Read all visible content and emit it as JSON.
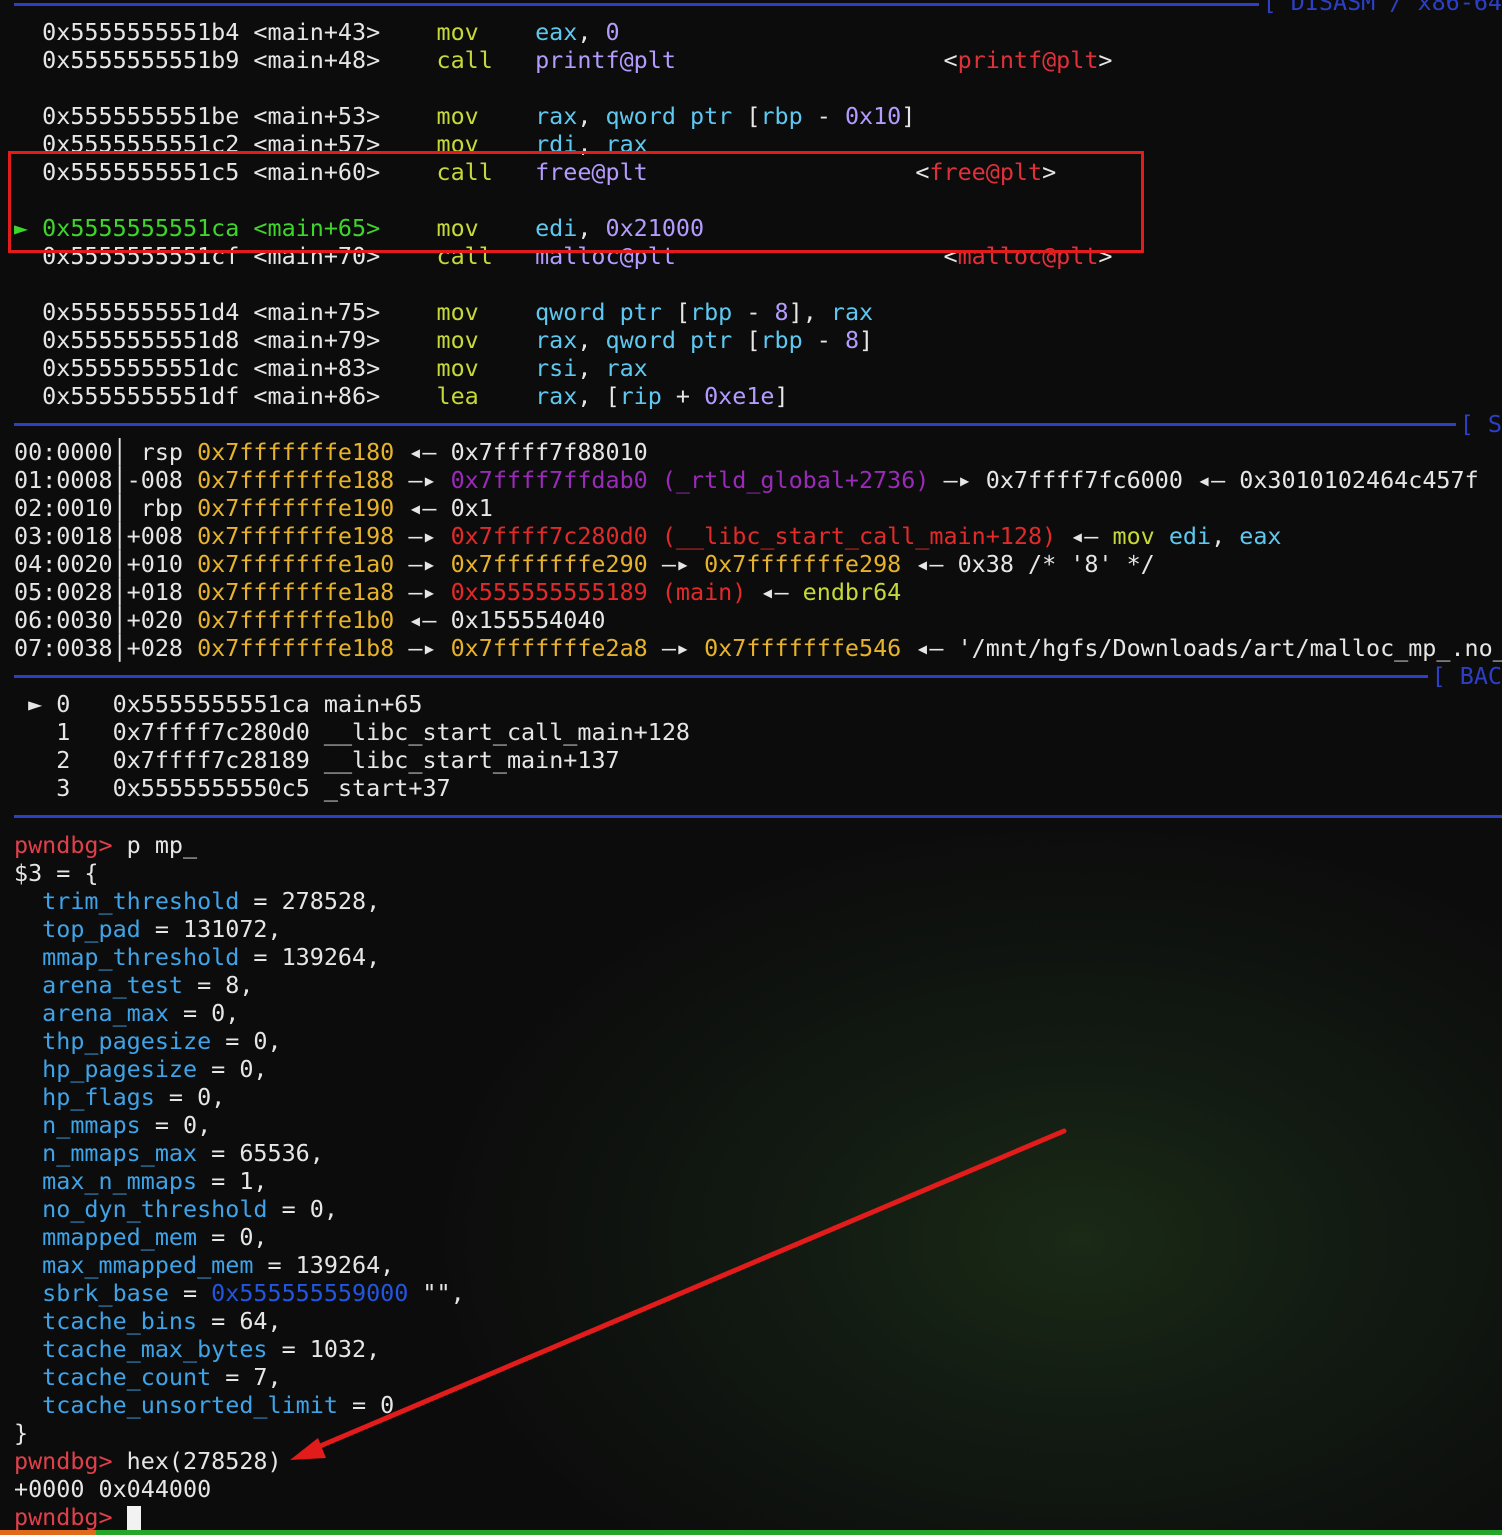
{
  "sections": {
    "disasm": "[ DISASM / x86-64",
    "stack": "[ S",
    "backtrace": "[ BAC"
  },
  "disasm": [
    {
      "addr": "0x5555555551b4",
      "sym": "<main+43>",
      "op": "mov",
      "args": [
        [
          "eax",
          "reg"
        ],
        [
          ", ",
          "str"
        ],
        [
          "0",
          "num"
        ]
      ],
      "ann": ""
    },
    {
      "addr": "0x5555555551b9",
      "sym": "<main+48>",
      "op": "call",
      "args": [
        [
          "printf@plt",
          "sym"
        ]
      ],
      "ann": "printf@plt"
    },
    {
      "addr": "0x5555555551be",
      "sym": "<main+53>",
      "op": "mov",
      "args": [
        [
          "rax",
          "reg"
        ],
        [
          ", ",
          "str"
        ],
        [
          "qword ptr",
          "reg"
        ],
        [
          " [",
          "str"
        ],
        [
          "rbp",
          "reg"
        ],
        [
          " - ",
          "str"
        ],
        [
          "0x10",
          "num"
        ],
        [
          "]",
          "str"
        ]
      ],
      "ann": ""
    },
    {
      "addr": "0x5555555551c2",
      "sym": "<main+57>",
      "op": "mov",
      "args": [
        [
          "rdi",
          "reg"
        ],
        [
          ", ",
          "str"
        ],
        [
          "rax",
          "reg"
        ]
      ],
      "ann": ""
    },
    {
      "addr": "0x5555555551c5",
      "sym": "<main+60>",
      "op": "call",
      "args": [
        [
          "free@plt",
          "sym"
        ]
      ],
      "ann": "free@plt"
    },
    {
      "addr": "0x5555555551ca",
      "sym": "<main+65>",
      "op": "mov",
      "args": [
        [
          "edi",
          "reg"
        ],
        [
          ", ",
          "str"
        ],
        [
          "0x21000",
          "num"
        ]
      ],
      "ann": "",
      "current": true
    },
    {
      "addr": "0x5555555551cf",
      "sym": "<main+70>",
      "op": "call",
      "args": [
        [
          "malloc@plt",
          "sym"
        ]
      ],
      "ann": "malloc@plt"
    },
    {
      "addr": "0x5555555551d4",
      "sym": "<main+75>",
      "op": "mov",
      "args": [
        [
          "qword ptr",
          "reg"
        ],
        [
          " [",
          "str"
        ],
        [
          "rbp",
          "reg"
        ],
        [
          " - ",
          "str"
        ],
        [
          "8",
          "num"
        ],
        [
          "], ",
          "str"
        ],
        [
          "rax",
          "reg"
        ]
      ],
      "ann": ""
    },
    {
      "addr": "0x5555555551d8",
      "sym": "<main+79>",
      "op": "mov",
      "args": [
        [
          "rax",
          "reg"
        ],
        [
          ", ",
          "str"
        ],
        [
          "qword ptr",
          "reg"
        ],
        [
          " [",
          "str"
        ],
        [
          "rbp",
          "reg"
        ],
        [
          " - ",
          "str"
        ],
        [
          "8",
          "num"
        ],
        [
          "]",
          "str"
        ]
      ],
      "ann": ""
    },
    {
      "addr": "0x5555555551dc",
      "sym": "<main+83>",
      "op": "mov",
      "args": [
        [
          "rsi",
          "reg"
        ],
        [
          ", ",
          "str"
        ],
        [
          "rax",
          "reg"
        ]
      ],
      "ann": ""
    },
    {
      "addr": "0x5555555551df",
      "sym": "<main+86>",
      "op": "lea",
      "args": [
        [
          "rax",
          "reg"
        ],
        [
          ", [",
          "str"
        ],
        [
          "rip",
          "reg"
        ],
        [
          " + ",
          "str"
        ],
        [
          "0xe1e",
          "num"
        ],
        [
          "]",
          "str"
        ]
      ],
      "ann": ""
    }
  ],
  "stack": [
    [
      [
        "00:0000",
        "str"
      ],
      [
        "│ ",
        "str"
      ],
      [
        "rsp ",
        "str"
      ],
      [
        "0x7fffffffe180",
        "stk"
      ],
      [
        " ◂— ",
        "str"
      ],
      [
        "0x7ffff7f88010",
        "str"
      ]
    ],
    [
      [
        "01:0008",
        "str"
      ],
      [
        "│",
        "str"
      ],
      [
        "-008 ",
        "str"
      ],
      [
        "0x7fffffffe188",
        "stk"
      ],
      [
        " —▸ ",
        "str"
      ],
      [
        "0x7ffff7ffdab0 (_rtld_global+2736)",
        "purp"
      ],
      [
        " —▸ ",
        "str"
      ],
      [
        "0x7ffff7fc6000",
        "str"
      ],
      [
        " ◂— ",
        "str"
      ],
      [
        "0x3010102464c457f",
        "str"
      ]
    ],
    [
      [
        "02:0010",
        "str"
      ],
      [
        "│ ",
        "str"
      ],
      [
        "rbp ",
        "str"
      ],
      [
        "0x7fffffffe190",
        "stk"
      ],
      [
        " ◂— ",
        "str"
      ],
      [
        "0x1",
        "str"
      ]
    ],
    [
      [
        "03:0018",
        "str"
      ],
      [
        "│",
        "str"
      ],
      [
        "+008 ",
        "str"
      ],
      [
        "0x7fffffffe198",
        "stk"
      ],
      [
        " —▸ ",
        "str"
      ],
      [
        "0x7ffff7c280d0 (__libc_start_call_main+128)",
        "code"
      ],
      [
        " ◂— ",
        "str"
      ],
      [
        "mov ",
        "green-op"
      ],
      [
        "edi",
        "reg"
      ],
      [
        ", ",
        "str"
      ],
      [
        "eax",
        "reg"
      ]
    ],
    [
      [
        "04:0020",
        "str"
      ],
      [
        "│",
        "str"
      ],
      [
        "+010 ",
        "str"
      ],
      [
        "0x7fffffffe1a0",
        "stk"
      ],
      [
        " —▸ ",
        "str"
      ],
      [
        "0x7fffffffe290",
        "stk"
      ],
      [
        " —▸ ",
        "str"
      ],
      [
        "0x7fffffffe298",
        "stk"
      ],
      [
        " ◂— ",
        "str"
      ],
      [
        "0x38 /* '8' */",
        "str"
      ]
    ],
    [
      [
        "05:0028",
        "str"
      ],
      [
        "│",
        "str"
      ],
      [
        "+018 ",
        "str"
      ],
      [
        "0x7fffffffe1a8",
        "stk"
      ],
      [
        " —▸ ",
        "str"
      ],
      [
        "0x555555555189 (main)",
        "code"
      ],
      [
        " ◂— ",
        "str"
      ],
      [
        "endbr64",
        "green-op"
      ]
    ],
    [
      [
        "06:0030",
        "str"
      ],
      [
        "│",
        "str"
      ],
      [
        "+020 ",
        "str"
      ],
      [
        "0x7fffffffe1b0",
        "stk"
      ],
      [
        " ◂— ",
        "str"
      ],
      [
        "0x155554040",
        "str"
      ]
    ],
    [
      [
        "07:0038",
        "str"
      ],
      [
        "│",
        "str"
      ],
      [
        "+028 ",
        "str"
      ],
      [
        "0x7fffffffe1b8",
        "stk"
      ],
      [
        " —▸ ",
        "str"
      ],
      [
        "0x7fffffffe2a8",
        "stk"
      ],
      [
        " —▸ ",
        "str"
      ],
      [
        "0x7fffffffe546",
        "stk"
      ],
      [
        " ◂— ",
        "str"
      ],
      [
        "'/mnt/hgfs/Downloads/art/malloc_mp_.no_",
        "str"
      ]
    ]
  ],
  "backtrace": [
    {
      "marker": "►",
      "idx": "0",
      "addr": "0x5555555551ca",
      "sym": "main+65"
    },
    {
      "marker": " ",
      "idx": "1",
      "addr": "0x7ffff7c280d0",
      "sym": "__libc_start_call_main+128"
    },
    {
      "marker": " ",
      "idx": "2",
      "addr": "0x7ffff7c28189",
      "sym": "__libc_start_main+137"
    },
    {
      "marker": " ",
      "idx": "3",
      "addr": "0x5555555550c5",
      "sym": "_start+37"
    }
  ],
  "prompt": "pwndbg>",
  "command1": "p mp_",
  "result_head": "$3 = {",
  "fields": [
    {
      "name": "trim_threshold",
      "value": "278528,"
    },
    {
      "name": "top_pad",
      "value": "131072,"
    },
    {
      "name": "mmap_threshold",
      "value": "139264,"
    },
    {
      "name": "arena_test",
      "value": "8,"
    },
    {
      "name": "arena_max",
      "value": "0,"
    },
    {
      "name": "thp_pagesize",
      "value": "0,"
    },
    {
      "name": "hp_pagesize",
      "value": "0,"
    },
    {
      "name": "hp_flags",
      "value": "0,"
    },
    {
      "name": "n_mmaps",
      "value": "0,"
    },
    {
      "name": "n_mmaps_max",
      "value": "65536,"
    },
    {
      "name": "max_n_mmaps",
      "value": "1,"
    },
    {
      "name": "no_dyn_threshold",
      "value": "0,"
    },
    {
      "name": "mmapped_mem",
      "value": "0,"
    },
    {
      "name": "max_mmapped_mem",
      "value": "139264,"
    },
    {
      "name": "sbrk_base",
      "value": "0x555555559000",
      "ptr": true,
      "tail": " \"\","
    },
    {
      "name": "tcache_bins",
      "value": "64,"
    },
    {
      "name": "tcache_max_bytes",
      "value": "1032,"
    },
    {
      "name": "tcache_count",
      "value": "7,"
    },
    {
      "name": "tcache_unsorted_limit",
      "value": "0"
    }
  ],
  "result_tail": "}",
  "command2": "hex(278528)",
  "hex_output": "+0000 0x044000",
  "colors": {
    "section_rule": "#2d3fc5",
    "highlight_box": "#e21b1b",
    "arrow": "#e21b1b"
  }
}
